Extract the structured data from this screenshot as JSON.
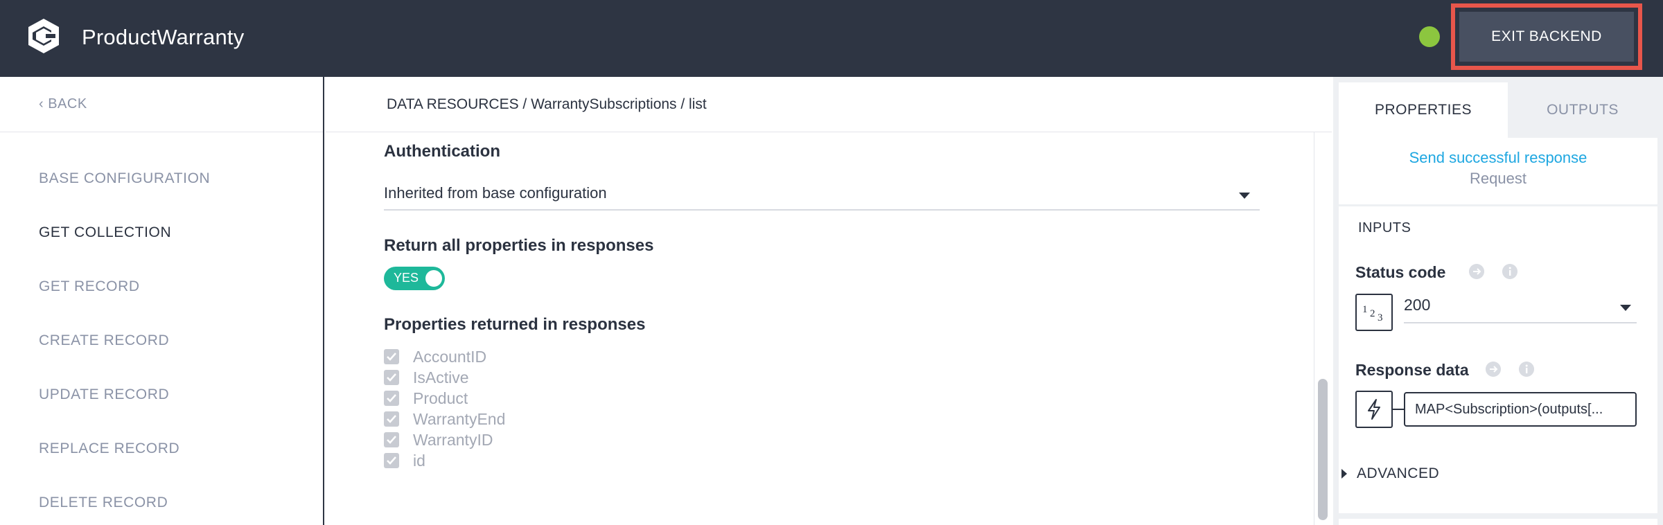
{
  "header": {
    "app_title": "ProductWarranty",
    "exit_label": "EXIT BACKEND",
    "status_color": "#8cc63f",
    "highlight_color": "#e8564b"
  },
  "sidebar": {
    "back_label": "‹ BACK",
    "items": [
      {
        "label": "BASE CONFIGURATION",
        "active": false
      },
      {
        "label": "GET COLLECTION",
        "active": true
      },
      {
        "label": "GET RECORD",
        "active": false
      },
      {
        "label": "CREATE RECORD",
        "active": false
      },
      {
        "label": "UPDATE RECORD",
        "active": false
      },
      {
        "label": "REPLACE RECORD",
        "active": false
      },
      {
        "label": "DELETE RECORD",
        "active": false
      }
    ]
  },
  "main": {
    "breadcrumb": "DATA RESOURCES / WarrantySubscriptions / list",
    "authentication": {
      "title": "Authentication",
      "value": "Inherited from base configuration"
    },
    "return_all": {
      "title": "Return all properties in responses",
      "toggle_label": "YES",
      "toggle_on": true
    },
    "properties": {
      "title": "Properties returned in responses",
      "items": [
        "AccountID",
        "IsActive",
        "Product",
        "WarrantyEnd",
        "WarrantyID",
        "id"
      ]
    }
  },
  "right_panel": {
    "tabs": [
      "PROPERTIES",
      "OUTPUTS"
    ],
    "active_tab": "PROPERTIES",
    "node": {
      "link": "Send successful response",
      "type": "Request"
    },
    "inputs_title": "INPUTS",
    "status_code": {
      "label": "Status code",
      "type_icon": "123",
      "value": "200"
    },
    "response_data": {
      "label": "Response data",
      "value": "MAP<Subscription>(outputs[..."
    },
    "advanced_label": "ADVANCED"
  }
}
